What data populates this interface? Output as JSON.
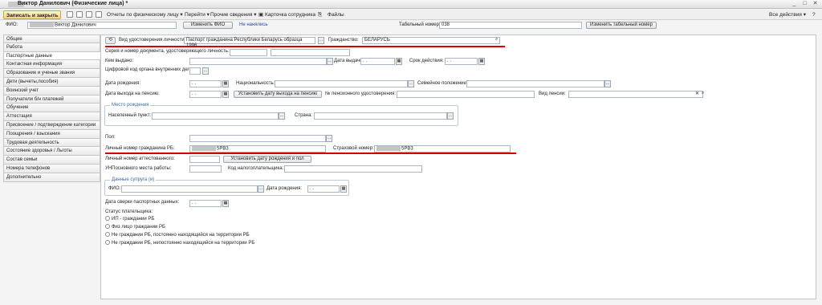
{
  "window": {
    "title": "Виктор Данилович (Физические лица) *"
  },
  "toolbar": {
    "save_close": "Записать и закрыть",
    "reports": "Отчеты по физическому лицу",
    "goto": "Перейти",
    "other_info": "Прочие сведения",
    "employee_card": "Карточка сотрудника",
    "files": "Файлы",
    "all_actions": "Все действия"
  },
  "header": {
    "fio_label": "ФИО:",
    "fio_value": "Виктор Данилович",
    "change_fio": "Изменить ФИО",
    "not_hired": "Не нанялись",
    "tabnum_label": "Табельный номер:",
    "tabnum_value": "038",
    "change_tabnum": "Изменить табельный номер"
  },
  "sidebar": {
    "items": [
      "Общие",
      "Работа",
      "Паспортные данные",
      "Контактная информация",
      "Образование и ученые звания",
      "Дети (вычеты,пособия)",
      "Воинский учет",
      "Получатели б/н платежей",
      "Обучение",
      "Аттестация",
      "Присвоение / подтверждение категории",
      "Поощрения / взыскания",
      "Трудовая деятельность",
      "Состояние здоровья / Льготы",
      "Состав семьи",
      "Номера телефонов",
      "Дополнительно"
    ]
  },
  "form": {
    "doc_type_label": "Вид удостоверения личности:",
    "doc_type_value": "Паспорт гражданина Республики Беларусь образца 1996",
    "citizenship_label": "Гражданство:",
    "citizenship_value": "БЕЛАРУСЬ",
    "series_label": "Серия и номер документа, удостоверяющего личность:",
    "issued_by_label": "Кем выдано:",
    "issue_date_label": "Дата выдачи:",
    "validity_label": "Срок действия:",
    "digital_code_label": "Цифровой код органа внутренних дел:",
    "birth_date_label": "Дата рождения:",
    "nationality_label": "Национальность:",
    "marital_label": "Семейное положение:",
    "pension_date_label": "Дата выхода на пенсию:",
    "set_pension_date": "Установить дату выхода на пенсию",
    "pension_cert_label": "№ пенсионного удостоверения:",
    "pension_type_label": "Вид пенсии:",
    "birthplace_group": "Место рождения",
    "locality_label": "Населенный пункт:",
    "country_label": "Страна:",
    "sex_label": "Пол:",
    "personal_number_label": "Личный номер гражданина РБ:",
    "personal_number_value": "5РВ3",
    "insurance_label": "Страховой номер:",
    "insurance_value": "5РВ3",
    "attest_number_label": "Личный номер аттестованного:",
    "set_birth_sex": "Установить дату рождения и пол",
    "unp_label": "УНПосновного места работы:",
    "taxpayer_code_label": "Код налогоплательщика:",
    "spouse_group": "Данные супруга (и)",
    "spouse_fio_label": "ФИО:",
    "spouse_birth_label": "Дата рождения:",
    "passport_check_label": "Дата сверки паспортных данных:",
    "date_placeholder": ". .",
    "payer_status_label": "Статус плательщика:",
    "payer_options": [
      "ИП - граждании РБ",
      "Физ лицо граждании РБ",
      "Не граждании РБ, постоянно находящийся на территории РБ",
      "Не граждании РБ, непостоянно находящийся на территории РБ"
    ]
  },
  "icons": [
    "history-icon",
    "magnifier-icon",
    "calendar-icon",
    "clear-icon",
    "save-icon",
    "help-icon"
  ]
}
